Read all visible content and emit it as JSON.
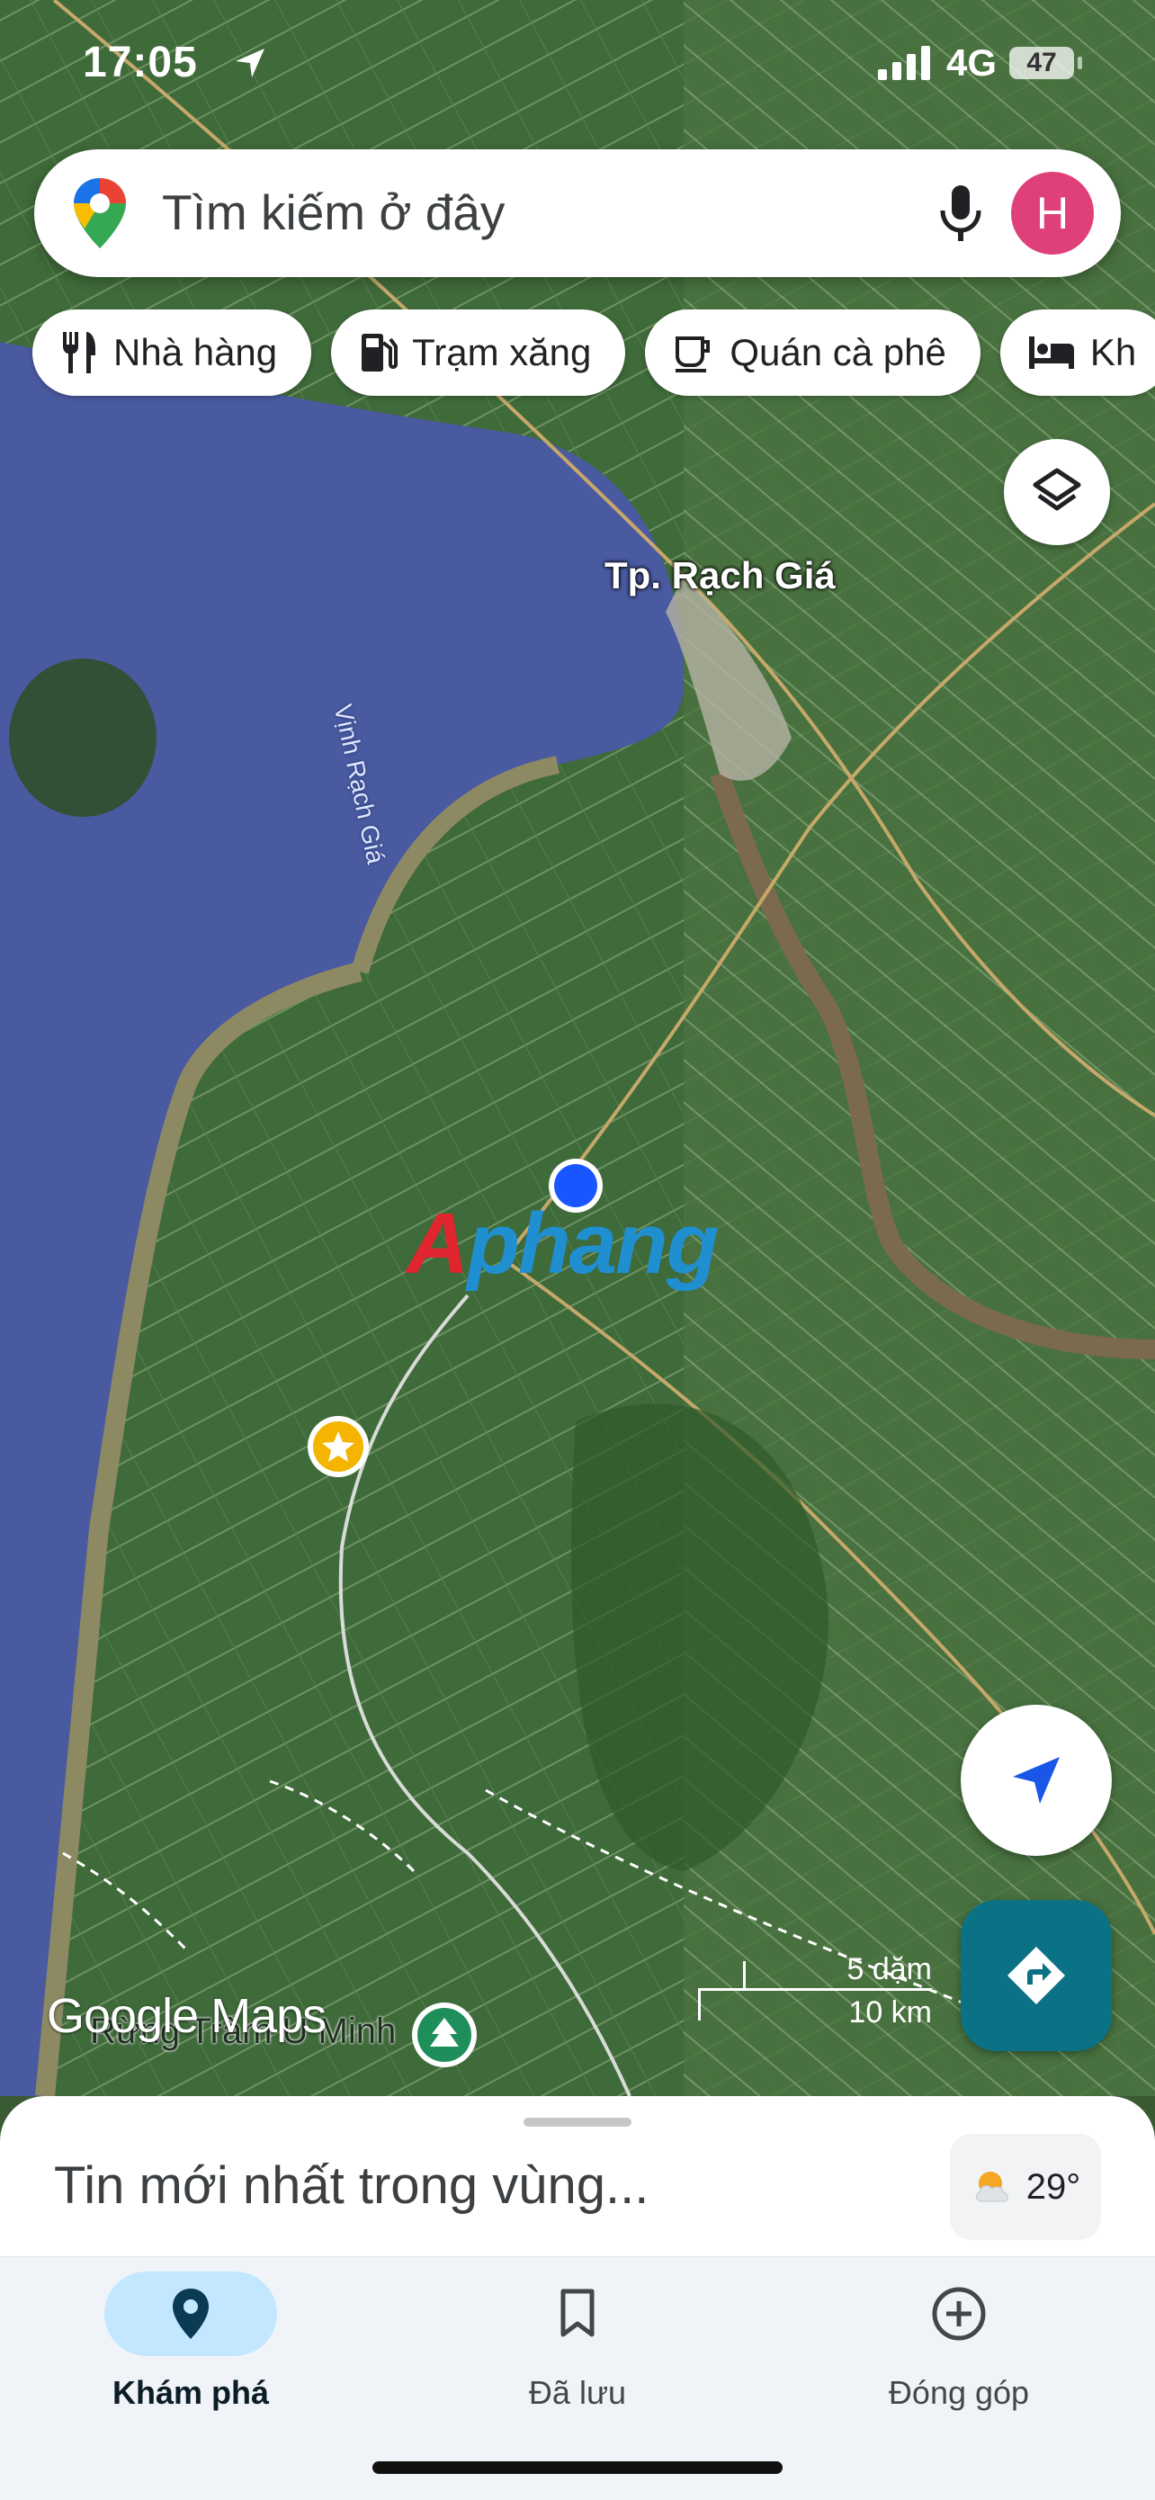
{
  "status_bar": {
    "time": "17:05",
    "network": "4G",
    "battery": "47"
  },
  "search": {
    "placeholder": "Tìm kiếm ở đây",
    "avatar_initial": "H"
  },
  "chips": [
    {
      "label": "Nhà hàng",
      "icon": "fork-knife-icon"
    },
    {
      "label": "Trạm xăng",
      "icon": "gas-station-icon"
    },
    {
      "label": "Quán cà phê",
      "icon": "coffee-cup-icon"
    },
    {
      "label": "Kh",
      "icon": "bed-icon"
    }
  ],
  "map": {
    "city_label": "Tp. Rạch Giá",
    "bay_label": "Vịnh Rạch Giá",
    "forest_label": "Rừng Tràm U Minh",
    "brand": "Google Maps",
    "watermark": {
      "first": "A",
      "rest": "phang"
    },
    "scale": {
      "miles": "5 dặm",
      "km": "10 km"
    }
  },
  "sheet": {
    "title": "Tin mới nhất trong vùng...",
    "temperature": "29°"
  },
  "nav": {
    "explore": "Khám phá",
    "saved": "Đã lưu",
    "contribute": "Đóng góp"
  }
}
